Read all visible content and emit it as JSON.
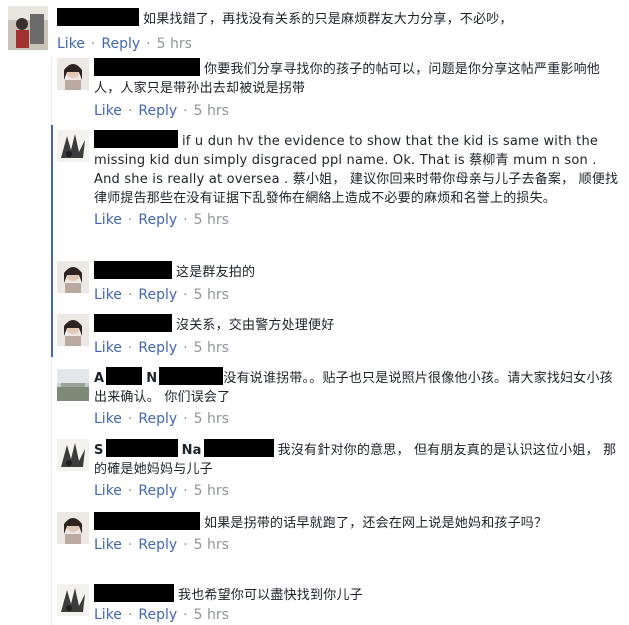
{
  "actions": {
    "like": "Like",
    "reply": "Reply",
    "separator": "·"
  },
  "comments": [
    {
      "text": "如果找錯了，再找没有关系的只是麻烦群友大力分享，不必吵，",
      "time": "5 hrs"
    },
    {
      "text": "你要我们分享寻找你的孩子的帖可以，问题是你分享这帖严重影响他人，人家只是带孙出去却被说是拐带",
      "time": "5 hrs"
    },
    {
      "text": "if u dun hv the evidence to show that the kid is same with the missing kid dun simply disgraced ppl name. Ok. That is 蔡柳青 mum n son . And she is really at oversea . 蔡小姐， 建议你回来时带你母亲与儿子去备案， 顺便找律师提告那些在没有证据下乱發佈在網絡上造成不必要的麻烦和名誉上的损失。",
      "time": "5 hrs"
    },
    {
      "text": "这是群友拍的",
      "time": "5 hrs"
    },
    {
      "text": "沒关系，交由警方处理便好",
      "time": "5 hrs"
    },
    {
      "name_prefix": "A",
      "name_mid": "N",
      "text": "没有说谁拐带。。贴子也只是说照片很像他小孩。请大家找妇女小孩出来确认。 你们误会了",
      "time": "5 hrs"
    },
    {
      "name_prefix": "S",
      "name_mid": "Na",
      "text": "我沒有針对你的意思， 但有朋友真的是认识这位小姐， 那的確是她妈妈与儿子",
      "time": "5 hrs"
    },
    {
      "text": "如果是拐带的话早就跑了，还会在网上说是她妈和孩子吗？",
      "time": "5 hrs"
    },
    {
      "text": "我也希望你可以盡快找到你儿子",
      "time": "5 hrs"
    }
  ]
}
